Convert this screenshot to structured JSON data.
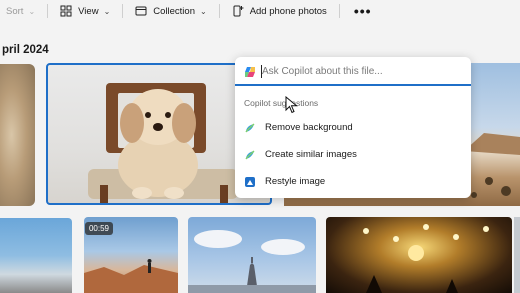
{
  "toolbar": {
    "sort_label": "Sort",
    "view_label": "View",
    "collection_label": "Collection",
    "add_phone_photos_label": "Add phone photos",
    "more_label": "•••"
  },
  "gallery": {
    "month_heading": "pril 2024",
    "video_duration": "00:59"
  },
  "copilot": {
    "ask_placeholder": "Ask Copilot about this file...",
    "suggestions_header": "Copilot suggestions",
    "suggestions": [
      {
        "label": "Remove background",
        "icon": "remove-background-icon"
      },
      {
        "label": "Create similar images",
        "icon": "create-similar-icon"
      },
      {
        "label": "Restyle image",
        "icon": "restyle-image-icon"
      }
    ]
  },
  "colors": {
    "accent": "#1f6fc8",
    "background": "#f3f3f3",
    "panel": "#ffffff"
  }
}
